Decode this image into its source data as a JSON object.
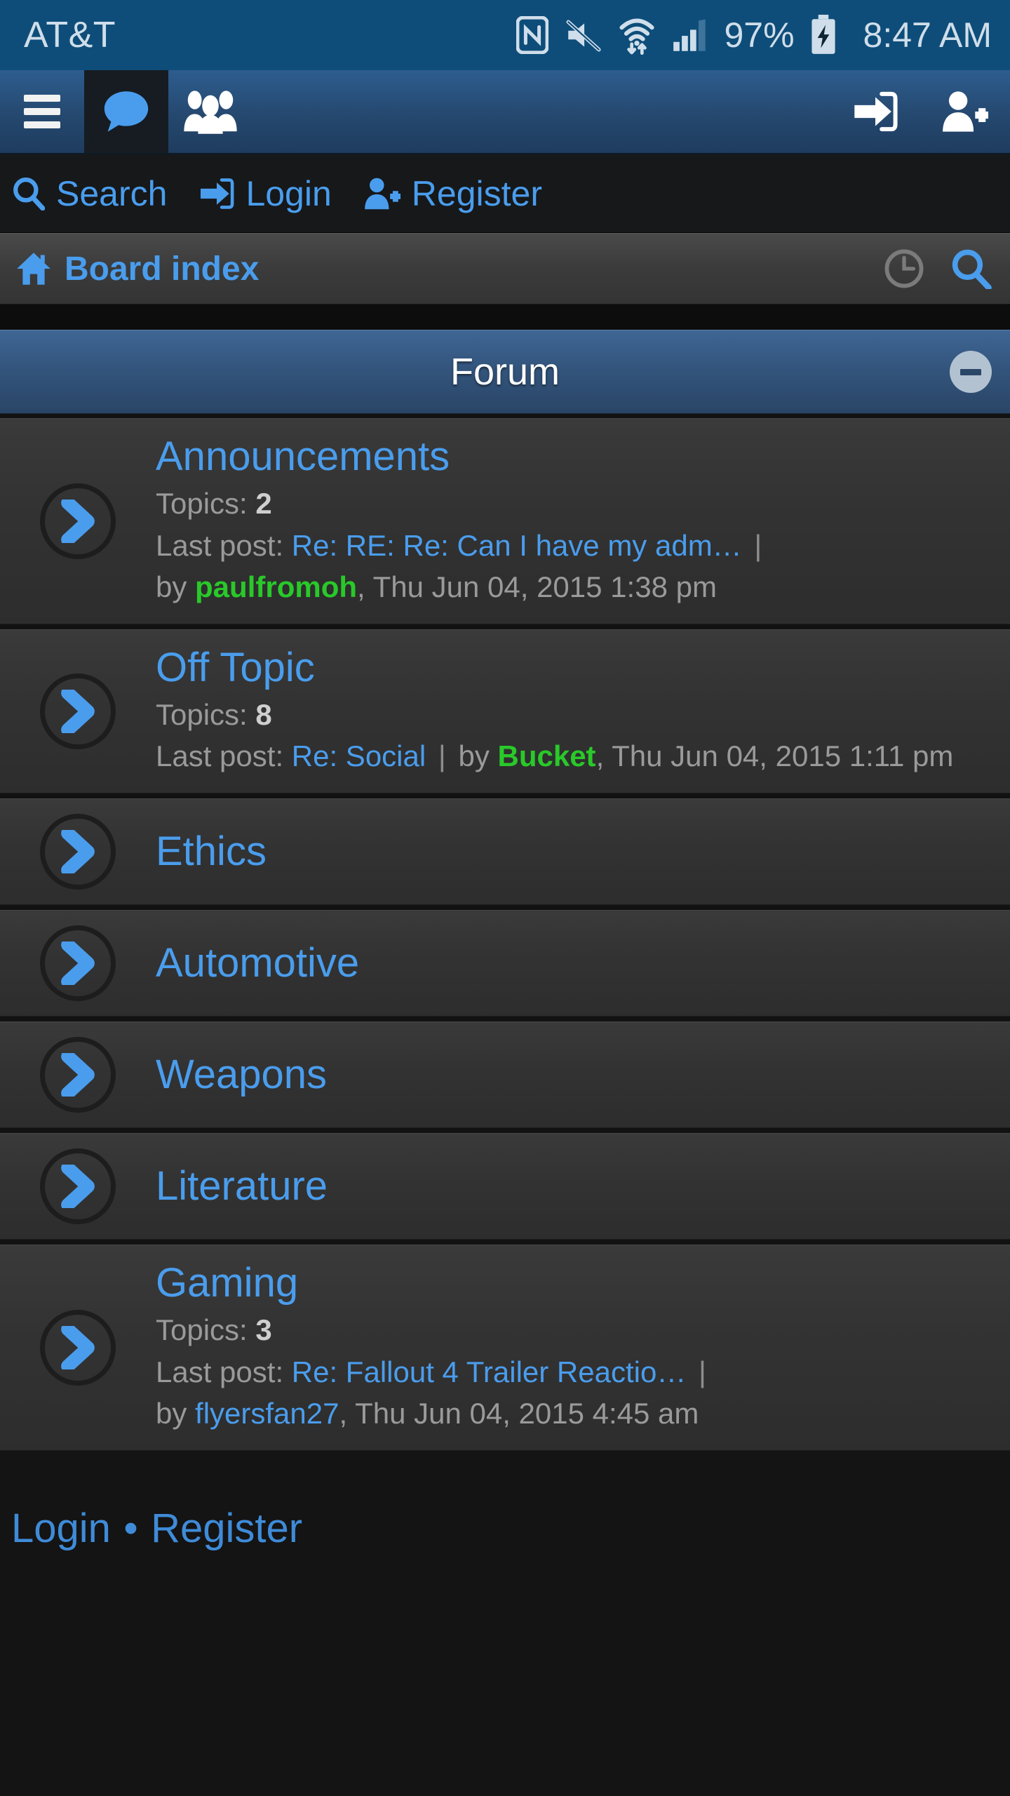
{
  "status_bar": {
    "carrier": "AT&T",
    "battery_percent": "97%",
    "time": "8:47 AM",
    "icons": [
      "nfc-icon",
      "mute-icon",
      "wifi-icon",
      "cellular-signal-icon",
      "battery-charging-icon"
    ]
  },
  "primary_nav": {
    "menu_icon": "hamburger-menu-icon",
    "tabs": [
      {
        "name": "chat-bubble-icon",
        "active": true
      },
      {
        "name": "members-group-icon",
        "active": false
      }
    ],
    "right_actions": [
      {
        "name": "login-icon"
      },
      {
        "name": "register-user-icon"
      }
    ]
  },
  "link_bar": {
    "items": [
      {
        "label": "Search",
        "icon": "search-icon"
      },
      {
        "label": "Login",
        "icon": "login-icon"
      },
      {
        "label": "Register",
        "icon": "register-user-icon"
      }
    ]
  },
  "breadcrumb": {
    "home_icon": "home-icon",
    "label": "Board index",
    "actions": [
      {
        "name": "recent-clock-icon"
      },
      {
        "name": "search-icon"
      }
    ]
  },
  "forum_section": {
    "title": "Forum",
    "collapse_icon": "collapse-minus-icon"
  },
  "forums": [
    {
      "title": "Announcements",
      "topics_label": "Topics:",
      "topics_count": "2",
      "last_post_label": "Last post:",
      "last_post_title": "Re: RE: Re: Can I have my adm…",
      "separator": "|",
      "by_label": "by",
      "author": "paulfromoh",
      "author_color": "green",
      "date": ", Thu Jun 04, 2015 1:38 pm",
      "layout": "stacked",
      "detailed": true
    },
    {
      "title": "Off Topic",
      "topics_label": "Topics:",
      "topics_count": "8",
      "last_post_label": "Last post:",
      "last_post_title": "Re: Social",
      "separator": "|",
      "by_label": "by",
      "author": "Bucket",
      "author_color": "green",
      "date": ", Thu Jun 04, 2015 1:11 pm",
      "layout": "inline",
      "detailed": true
    },
    {
      "title": "Ethics",
      "detailed": false
    },
    {
      "title": "Automotive",
      "detailed": false
    },
    {
      "title": "Weapons",
      "detailed": false
    },
    {
      "title": "Literature",
      "detailed": false
    },
    {
      "title": "Gaming",
      "topics_label": "Topics:",
      "topics_count": "3",
      "last_post_label": "Last post:",
      "last_post_title": "Re: Fallout 4 Trailer Reactio…",
      "separator": "|",
      "by_label": "by",
      "author": "flyersfan27",
      "author_color": "blue",
      "date": ", Thu Jun 04, 2015 4:45 am",
      "layout": "stacked",
      "detailed": true
    }
  ],
  "footer": {
    "login": "Login",
    "dot": "•",
    "register": "Register"
  },
  "colors": {
    "status_bar_bg": "#0e4d79",
    "link_blue": "#4a9ded",
    "user_green": "#29c929",
    "row_bg": "#353535",
    "page_bg": "#141414"
  }
}
